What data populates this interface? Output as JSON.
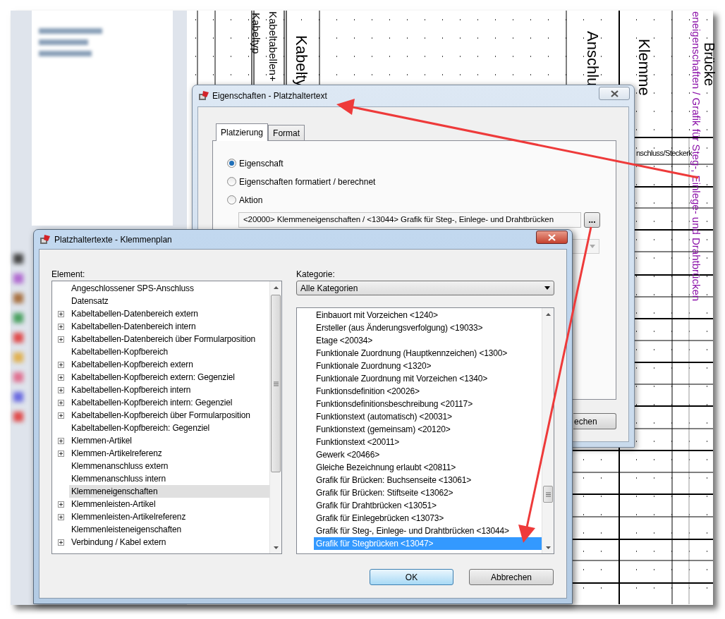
{
  "drawing": {
    "headers": [
      {
        "text": "Kabeltyp",
        "kind": "label"
      },
      {
        "text": "Kabeltabellen+",
        "kind": "label"
      },
      {
        "text": "Kabelty",
        "kind": "label"
      },
      {
        "text": "Anschlu",
        "kind": "label"
      },
      {
        "text": "Klemme",
        "kind": "label"
      },
      {
        "text": "Brücke",
        "kind": "label"
      },
      {
        "text": "eneigenschaften / Grafik für Steg-, Einlege- und Drahtbrücken",
        "kind": "placeholder"
      }
    ],
    "cell_text": "nschluss/Steckerk"
  },
  "properties_dialog": {
    "title": "Eigenschaften - Platzhaltertext",
    "tabs": [
      {
        "label": "Platzierung",
        "selected": true
      },
      {
        "label": "Format",
        "selected": false
      }
    ],
    "options": [
      {
        "label": "Eigenschaft",
        "selected": true
      },
      {
        "label": "Eigenschaften formatiert / berechnet",
        "selected": false
      },
      {
        "label": "Aktion",
        "selected": false
      }
    ],
    "value_field": {
      "value": "<20000> Klemmeneigenschaften / <13044> Grafik für Steg-, Einlege- und Drahtbrücken"
    },
    "browse_button": "...",
    "second_field": {
      "disabled": true
    },
    "cancel_button": "echen"
  },
  "placeholder_dialog": {
    "title": "Platzhaltertexte - Klemmenplan",
    "element_label": "Element:",
    "elements": [
      {
        "label": "Angeschlossener SPS-Anschluss",
        "expandable": false,
        "selected": false
      },
      {
        "label": "Datensatz",
        "expandable": false,
        "selected": false
      },
      {
        "label": "Kabeltabellen-Datenbereich extern",
        "expandable": true,
        "selected": false
      },
      {
        "label": "Kabeltabellen-Datenbereich intern",
        "expandable": true,
        "selected": false
      },
      {
        "label": "Kabeltabellen-Datenbereich über Formularposition",
        "expandable": true,
        "selected": false
      },
      {
        "label": "Kabeltabellen-Kopfbereich",
        "expandable": false,
        "selected": false
      },
      {
        "label": "Kabeltabellen-Kopfbereich extern",
        "expandable": true,
        "selected": false
      },
      {
        "label": "Kabeltabellen-Kopfbereich extern: Gegenziel",
        "expandable": true,
        "selected": false
      },
      {
        "label": "Kabeltabellen-Kopfbereich intern",
        "expandable": true,
        "selected": false
      },
      {
        "label": "Kabeltabellen-Kopfbereich intern: Gegenziel",
        "expandable": true,
        "selected": false
      },
      {
        "label": "Kabeltabellen-Kopfbereich über Formularposition",
        "expandable": true,
        "selected": false
      },
      {
        "label": "Kabeltabellen-Kopfbereich: Gegenziel",
        "expandable": false,
        "selected": false
      },
      {
        "label": "Klemmen-Artikel",
        "expandable": true,
        "selected": false
      },
      {
        "label": "Klemmen-Artikelreferenz",
        "expandable": true,
        "selected": false
      },
      {
        "label": "Klemmenanschluss extern",
        "expandable": false,
        "selected": false
      },
      {
        "label": "Klemmenanschluss intern",
        "expandable": false,
        "selected": false
      },
      {
        "label": "Klemmeneigenschaften",
        "expandable": false,
        "selected": true
      },
      {
        "label": "Klemmenleisten-Artikel",
        "expandable": true,
        "selected": false
      },
      {
        "label": "Klemmenleisten-Artikelreferenz",
        "expandable": true,
        "selected": false
      },
      {
        "label": "Klemmenleisteneigenschaften",
        "expandable": false,
        "selected": false
      },
      {
        "label": "Verbindung / Kabel extern",
        "expandable": true,
        "selected": false
      }
    ],
    "category_label": "Kategorie:",
    "category": {
      "value": "Alle Kategorien"
    },
    "properties": [
      {
        "label": "Einbauort mit Vorzeichen <1240>",
        "selected": false
      },
      {
        "label": "Ersteller (aus Änderungsverfolgung) <19033>",
        "selected": false
      },
      {
        "label": "Etage <20034>",
        "selected": false
      },
      {
        "label": "Funktionale Zuordnung (Hauptkennzeichen) <1300>",
        "selected": false
      },
      {
        "label": "Funktionale Zuordnung <1320>",
        "selected": false
      },
      {
        "label": "Funktionale Zuordnung mit Vorzeichen <1340>",
        "selected": false
      },
      {
        "label": "Funktionsdefinition <20026>",
        "selected": false
      },
      {
        "label": "Funktionsdefinitionsbeschreibung <20117>",
        "selected": false
      },
      {
        "label": "Funktionstext (automatisch) <20031>",
        "selected": false
      },
      {
        "label": "Funktionstext (gemeinsam) <20120>",
        "selected": false
      },
      {
        "label": "Funktionstext <20011>",
        "selected": false
      },
      {
        "label": "Gewerk <20466>",
        "selected": false
      },
      {
        "label": "Gleiche Bezeichnung erlaubt <20811>",
        "selected": false
      },
      {
        "label": "Grafik für Brücken: Buchsenseite <13061>",
        "selected": false
      },
      {
        "label": "Grafik für Brücken: Stiftseite <13062>",
        "selected": false
      },
      {
        "label": "Grafik für Drahtbrücken <13051>",
        "selected": false
      },
      {
        "label": "Grafik für Einlegebrücken <13073>",
        "selected": false
      },
      {
        "label": "Grafik für Steg-, Einlege- und Drahtbrücken <13044>",
        "selected": false
      },
      {
        "label": "Grafik für Stegbrücken <13047>",
        "selected": true
      }
    ],
    "ok_button": "OK",
    "cancel_button": "Abbrechen"
  }
}
